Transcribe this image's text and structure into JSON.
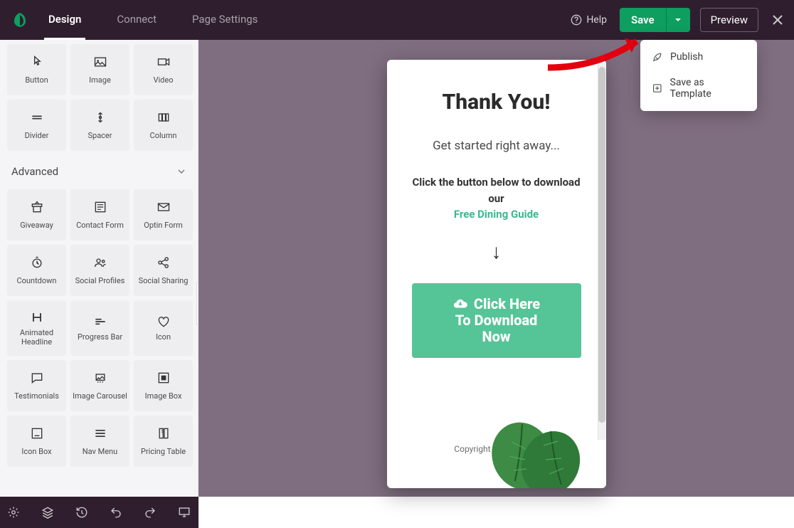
{
  "topbar": {
    "tabs": {
      "design": "Design",
      "connect": "Connect",
      "pageSettings": "Page Settings"
    },
    "help": "Help",
    "save": "Save",
    "preview": "Preview"
  },
  "saveDropdown": {
    "publish": "Publish",
    "saveTemplate": "Save as Template"
  },
  "sidebar": {
    "sectionAdvanced": "Advanced",
    "blocks_basic": [
      {
        "label": "Button"
      },
      {
        "label": "Image"
      },
      {
        "label": "Video"
      },
      {
        "label": "Divider"
      },
      {
        "label": "Spacer"
      },
      {
        "label": "Column"
      }
    ],
    "blocks_advanced": [
      {
        "label": "Giveaway"
      },
      {
        "label": "Contact Form"
      },
      {
        "label": "Optin Form"
      },
      {
        "label": "Countdown"
      },
      {
        "label": "Social Profiles"
      },
      {
        "label": "Social Sharing"
      },
      {
        "label": "Animated Headline"
      },
      {
        "label": "Progress Bar"
      },
      {
        "label": "Icon"
      },
      {
        "label": "Testimonials"
      },
      {
        "label": "Image Carousel"
      },
      {
        "label": "Image Box"
      },
      {
        "label": "Icon Box"
      },
      {
        "label": "Nav Menu"
      },
      {
        "label": "Pricing Table"
      }
    ]
  },
  "canvas": {
    "title": "Thank You!",
    "subtitle": "Get started right away...",
    "copy1": "Click the button below to download our",
    "copy2": "Free Dining Guide",
    "arrow": "↓",
    "cta_line1": "Click Here",
    "cta_line2": "To Download",
    "cta_line3": "Now",
    "copyright": "Copyright © SeedProd"
  }
}
